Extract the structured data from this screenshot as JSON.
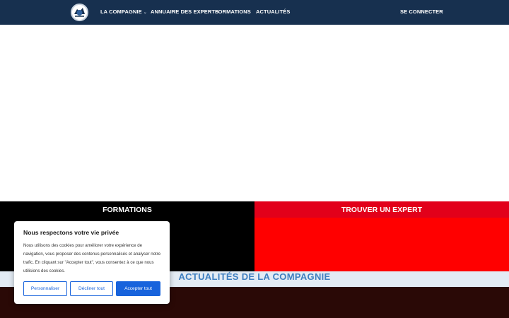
{
  "nav": {
    "items": [
      {
        "label": "LA COMPAGNIE",
        "has_dropdown": true
      },
      {
        "label": "ANNUAIRE DES EXPERTS",
        "has_dropdown": false
      },
      {
        "label": "FORMATIONS",
        "has_dropdown": false
      },
      {
        "label": "ACTUALITÉS",
        "has_dropdown": false
      }
    ],
    "login_label": "SE CONNECTER"
  },
  "panels": {
    "left_title": "FORMATIONS",
    "right_title": "TROUVER UN EXPERT"
  },
  "news": {
    "title": "ACTUALITÉS DE LA COMPAGNIE"
  },
  "cookie_banner": {
    "title": "Nous respectons votre vie privée",
    "text": "Nous utilisons des cookies pour améliorer votre expérience de navigation, vous proposer des contenus personnalisés et analyser notre trafic. En cliquant sur \"Accepter tout\", vous consentez à ce que nous utilisions des cookies.",
    "buttons": {
      "customize": "Personnaliser",
      "decline": "Décliner tout",
      "accept": "Accepter tout"
    }
  },
  "colors": {
    "nav_bg": "#17304f",
    "panel_left": "#000000",
    "panel_right": "#ff0000",
    "panel_right_header": "#e2001a",
    "news_band": "#e3ebf4",
    "news_title": "#3f7fc0",
    "bottom_band": "#2a0906",
    "cookie_accent": "#1863dc"
  },
  "icons": {
    "logo": "company-logo",
    "dropdown": "chevron-down-icon"
  }
}
